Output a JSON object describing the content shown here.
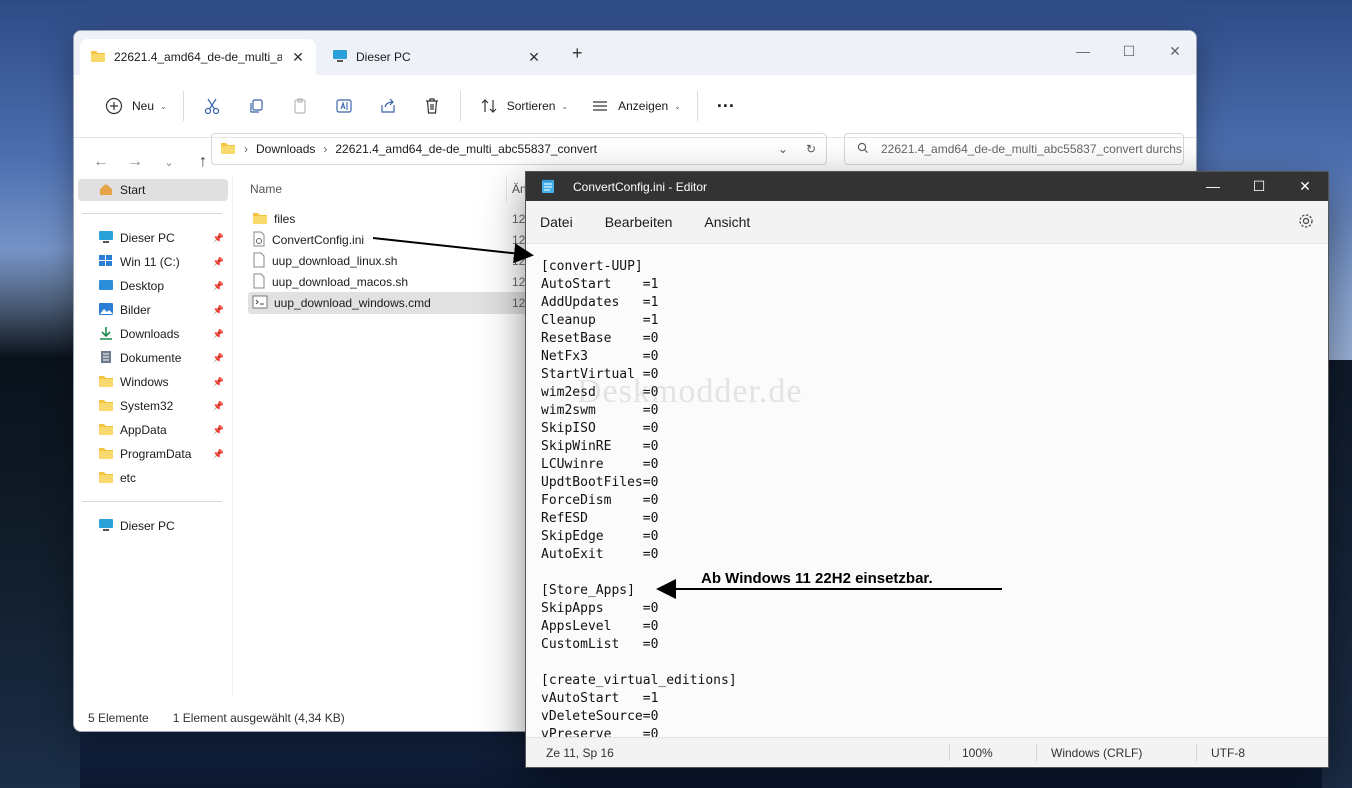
{
  "explorer": {
    "tabs": [
      {
        "label": "22621.4_amd64_de-de_multi_a"
      },
      {
        "label": "Dieser PC"
      }
    ],
    "toolbar": {
      "new_label": "Neu",
      "sort_label": "Sortieren",
      "view_label": "Anzeigen"
    },
    "address": {
      "crumbs": [
        "Downloads",
        "22621.4_amd64_de-de_multi_abc55837_convert"
      ]
    },
    "search": {
      "placeholder": "22621.4_amd64_de-de_multi_abc55837_convert durchs..."
    },
    "sidebar": {
      "items": [
        {
          "label": "Start"
        },
        {
          "label": "Dieser PC"
        },
        {
          "label": "Win 11 (C:)"
        },
        {
          "label": "Desktop"
        },
        {
          "label": "Bilder"
        },
        {
          "label": "Downloads"
        },
        {
          "label": "Dokumente"
        },
        {
          "label": "Windows"
        },
        {
          "label": "System32"
        },
        {
          "label": "AppData"
        },
        {
          "label": "ProgramData"
        },
        {
          "label": "etc"
        },
        {
          "label": "Dieser PC"
        }
      ]
    },
    "columns": {
      "name": "Name",
      "date": "Än"
    },
    "files": [
      {
        "name": "files",
        "date": "12"
      },
      {
        "name": "ConvertConfig.ini",
        "date": "12"
      },
      {
        "name": "uup_download_linux.sh",
        "date": "12"
      },
      {
        "name": "uup_download_macos.sh",
        "date": "12"
      },
      {
        "name": "uup_download_windows.cmd",
        "date": "12"
      }
    ],
    "status": {
      "count": "5 Elemente",
      "selection": "1 Element ausgewählt (4,34 KB)"
    }
  },
  "editor": {
    "title": "ConvertConfig.ini - Editor",
    "menu": {
      "file": "Datei",
      "edit": "Bearbeiten",
      "view": "Ansicht"
    },
    "lines": [
      "[convert-UUP]",
      "AutoStart    =1",
      "AddUpdates   =1",
      "Cleanup      =1",
      "ResetBase    =0",
      "NetFx3       =0",
      "StartVirtual =0",
      "wim2esd      =0",
      "wim2swm      =0",
      "SkipISO      =0",
      "SkipWinRE    =0",
      "LCUwinre     =0",
      "UpdtBootFiles=0",
      "ForceDism    =0",
      "RefESD       =0",
      "SkipEdge     =0",
      "AutoExit     =0",
      "",
      "[Store_Apps]",
      "SkipApps     =0",
      "AppsLevel    =0",
      "CustomList   =0",
      "",
      "[create_virtual_editions]",
      "vAutoStart   =1",
      "vDeleteSource=0",
      "vPreserve    =0"
    ],
    "status": {
      "position": "Ze 11, Sp 16",
      "zoom": "100%",
      "line_endings": "Windows (CRLF)",
      "encoding": "UTF-8"
    }
  },
  "watermark": "Deskmodder.de",
  "annotation": "Ab Windows 11 22H2 einsetzbar.",
  "colors": {
    "accent": "#0067c0",
    "folder": "#f3c342",
    "title_bar": "#333333"
  }
}
